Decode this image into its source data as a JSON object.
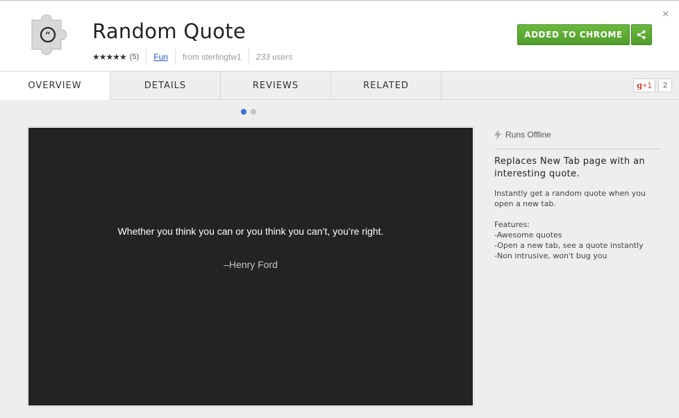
{
  "header": {
    "title": "Random Quote",
    "stars": "★★★★★",
    "rating_count": "(5)",
    "category": "Fun",
    "author": "from sterlingtw1",
    "users": "233 users",
    "added_label": "ADDED TO CHROME",
    "share_icon": "share-icon",
    "close_label": "×",
    "accent_color": "#5aa832"
  },
  "tabs": [
    "OVERVIEW",
    "DETAILS",
    "REVIEWS",
    "RELATED"
  ],
  "social": {
    "gplus_label": "+1",
    "gplus_prefix": "g",
    "count": "2"
  },
  "carousel": {
    "slides": 2,
    "active_index": 0
  },
  "screenshot": {
    "quote": "Whether you think you can or you think you can’t, you’re right.",
    "author": "–Henry Ford"
  },
  "sidebar": {
    "offline_label": "Runs Offline",
    "summary": "Replaces New Tab page with an interesting quote.",
    "description": "Instantly get a random quote when you open a new tab.",
    "features_heading": "Features:",
    "features": [
      "-Awesome quotes",
      "-Open a new tab, see a quote instantly",
      "-Non intrusive, won't bug you"
    ]
  }
}
